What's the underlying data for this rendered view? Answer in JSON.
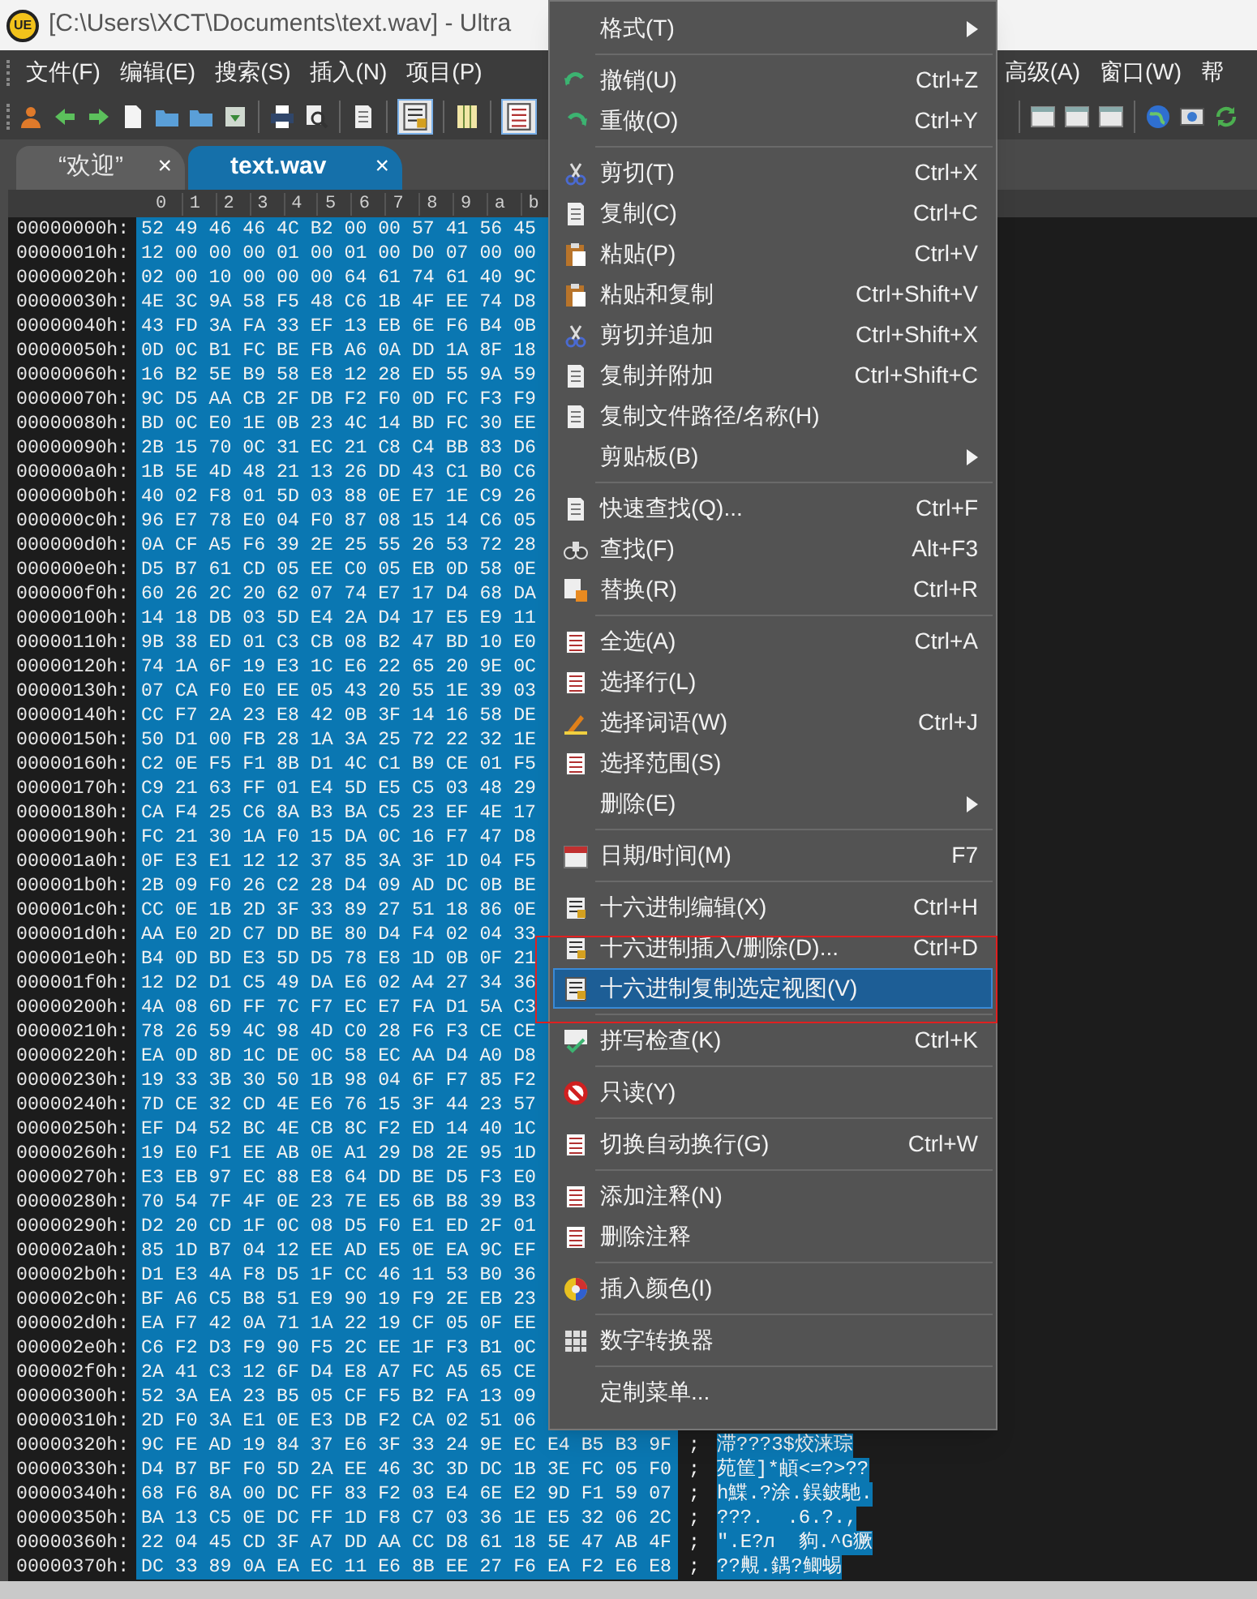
{
  "window": {
    "logo_text": "UE",
    "title": "[C:\\Users\\XCT\\Documents\\text.wav] - Ultra"
  },
  "menu_bar_left": [
    "文件(F)",
    "编辑(E)",
    "搜索(S)",
    "插入(N)",
    "项目(P)"
  ],
  "menu_bar_right": [
    "高级(A)",
    "窗口(W)",
    "帮"
  ],
  "tabs": [
    {
      "label": "“欢迎”",
      "close": "×",
      "selected": false
    },
    {
      "label": "text.wav",
      "close": "×",
      "selected": true
    }
  ],
  "hex_view": {
    "column_headers": [
      "0",
      "1",
      "2",
      "3",
      "4",
      "5",
      "6",
      "7",
      "8",
      "9",
      "a",
      "b"
    ],
    "rows": [
      {
        "address": "00000000h:",
        "bytes": "52 49 46 46 4C B2 00 00 57 41 56 45"
      },
      {
        "address": "00000010h:",
        "bytes": "12 00 00 00 01 00 01 00 D0 07 00 00"
      },
      {
        "address": "00000020h:",
        "bytes": "02 00 10 00 00 00 64 61 74 61 40 9C"
      },
      {
        "address": "00000030h:",
        "bytes": "4E 3C 9A 58 F5 48 C6 1B 4F EE 74 D8"
      },
      {
        "address": "00000040h:",
        "bytes": "43 FD 3A FA 33 EF 13 EB 6E F6 B4 0B"
      },
      {
        "address": "00000050h:",
        "bytes": "0D 0C B1 FC BE FB A6 0A DD 1A 8F 18"
      },
      {
        "address": "00000060h:",
        "bytes": "16 B2 5E B9 58 E8 12 28 ED 55 9A 59"
      },
      {
        "address": "00000070h:",
        "bytes": "9C D5 AA CB 2F DB F2 F0 0D FC F3 F9"
      },
      {
        "address": "00000080h:",
        "bytes": "BD 0C E0 1E 0B 23 4C 14 BD FC 30 EE"
      },
      {
        "address": "00000090h:",
        "bytes": "2B 15 70 0C 31 EC 21 C8 C4 BB 83 D6"
      },
      {
        "address": "000000a0h:",
        "bytes": "1B 5E 4D 48 21 13 26 DD 43 C1 B0 C6"
      },
      {
        "address": "000000b0h:",
        "bytes": "40 02 F8 01 5D 03 88 0E E7 1E C9 26"
      },
      {
        "address": "000000c0h:",
        "bytes": "96 E7 78 E0 04 F0 87 08 15 14 C6 05"
      },
      {
        "address": "000000d0h:",
        "bytes": "0A CF A5 F6 39 2E 25 55 26 53 72 28"
      },
      {
        "address": "000000e0h:",
        "bytes": "D5 B7 61 CD 05 EE C0 05 EB 0D 58 0E"
      },
      {
        "address": "000000f0h:",
        "bytes": "60 26 2C 20 62 07 74 E7 17 D4 68 DA"
      },
      {
        "address": "00000100h:",
        "bytes": "14 18 DB 03 5D E4 2A D4 17 E5 E9 11"
      },
      {
        "address": "00000110h:",
        "bytes": "9B 38 ED 01 C3 CB 08 B2 47 BD 10 E0"
      },
      {
        "address": "00000120h:",
        "bytes": "74 1A 6F 19 E3 1C E6 22 65 20 9E 0C"
      },
      {
        "address": "00000130h:",
        "bytes": "07 CA F0 E0 EE 05 43 20 55 1E 39 03"
      },
      {
        "address": "00000140h:",
        "bytes": "CC F7 2A 23 E8 42 0B 3F 14 16 58 DE"
      },
      {
        "address": "00000150h:",
        "bytes": "50 D1 00 FB 28 1A 3A 25 72 22 32 1E"
      },
      {
        "address": "00000160h:",
        "bytes": "C2 0E F5 F1 8B D1 4C C1 B9 CE 01 F5"
      },
      {
        "address": "00000170h:",
        "bytes": "C9 21 63 FF 01 E4 5D E5 C5 03 48 29"
      },
      {
        "address": "00000180h:",
        "bytes": "CA F4 25 C6 8A B3 BA C5 23 EF 4E 17"
      },
      {
        "address": "00000190h:",
        "bytes": "FC 21 30 1A F0 15 DA 0C 16 F7 47 D8"
      },
      {
        "address": "000001a0h:",
        "bytes": "0F E3 E1 12 12 37 85 3A 3F 1D 04 F5"
      },
      {
        "address": "000001b0h:",
        "bytes": "2B 09 F0 26 C2 28 D4 09 AD DC 0B BE"
      },
      {
        "address": "000001c0h:",
        "bytes": "CC 0E 1B 2D 3F 33 89 27 51 18 86 0E"
      },
      {
        "address": "000001d0h:",
        "bytes": "AA E0 2D C7 DD BE 80 D4 F4 02 04 33"
      },
      {
        "address": "000001e0h:",
        "bytes": "B4 0D BD E3 5D D5 78 E8 1D 0B 0F 21"
      },
      {
        "address": "000001f0h:",
        "bytes": "12 D2 D1 C5 49 DA E6 02 A4 27 34 36"
      },
      {
        "address": "00000200h:",
        "bytes": "4A 08 6D FF 7C F7 EC E7 FA D1 5A C3"
      },
      {
        "address": "00000210h:",
        "bytes": "78 26 59 4C 98 4D C0 28 F6 F3 CE CE"
      },
      {
        "address": "00000220h:",
        "bytes": "EA 0D 8D 1C DE 0C 58 EC AA D4 A0 D8"
      },
      {
        "address": "00000230h:",
        "bytes": "19 33 3B 30 50 1B 98 04 6F F7 85 F2"
      },
      {
        "address": "00000240h:",
        "bytes": "7D CE 32 CD 4E E6 76 15 3F 44 23 57"
      },
      {
        "address": "00000250h:",
        "bytes": "EF D4 52 BC 4E CB 8C F2 ED 14 40 1C"
      },
      {
        "address": "00000260h:",
        "bytes": "19 E0 F1 EE AB 0E A1 29 D8 2E 95 1D"
      },
      {
        "address": "00000270h:",
        "bytes": "E3 EB 97 EC 88 E8 64 DD BE D5 F3 E0"
      },
      {
        "address": "00000280h:",
        "bytes": "70 54 7F 4F 0E 23 7E E5 6B B8 39 B3"
      },
      {
        "address": "00000290h:",
        "bytes": "D2 20 CD 1F 0C 08 D5 F0 E1 ED 2F 01"
      },
      {
        "address": "000002a0h:",
        "bytes": "85 1D B7 04 12 EE AD E5 0E EA 9C EF"
      },
      {
        "address": "000002b0h:",
        "bytes": "D1 E3 4A F8 D5 1F CC 46 11 53 B0 36"
      },
      {
        "address": "000002c0h:",
        "bytes": "BF A6 C5 B8 51 E9 90 19 F9 2E EB 23"
      },
      {
        "address": "000002d0h:",
        "bytes": "EA F7 42 0A 71 1A 22 19 CF 05 0F EE"
      },
      {
        "address": "000002e0h:",
        "bytes": "C6 F2 D3 F9 90 F5 2C EE 1F F3 B1 0C"
      },
      {
        "address": "000002f0h:",
        "bytes": "2A 41 C3 12 6F D4 E8 A7 FC A5 65 CE"
      },
      {
        "address": "00000300h:",
        "bytes": "52 3A EA 23 B5 05 CF F5 B2 FA 13 09"
      },
      {
        "address": "00000310h:",
        "bytes": "2D F0 3A E1 0E E3 DB F2 CA 02 51 06"
      },
      {
        "address": "00000320h:",
        "bytes": "9C FE AD 19 84 37 E6 3F 33 24 9E EC E4 B5 B3 9F",
        "separator": ";",
        "text": "滞???3$烄涞琮"
      },
      {
        "address": "00000330h:",
        "bytes": "D4 B7 BF F0 5D 2A EE 46 3C 3D DC 1B 3E FC 05 F0",
        "separator": ";",
        "text": "苑筐]*頔<=?>??"
      },
      {
        "address": "00000340h:",
        "bytes": "68 F6 8A 00 DC FF 83 F2 03 E4 6E E2 9D F1 59 07",
        "separator": ";",
        "text": "h鰈.?涂.鋘鈹馳."
      },
      {
        "address": "00000350h:",
        "bytes": "BA 13 C5 0E DC FF 1D F8 C7 03 36 1E E5 32 06 2C",
        "separator": ";",
        "text": "???.  .6.?.,"
      },
      {
        "address": "00000360h:",
        "bytes": "22 04 45 CD 3F A7 DD AA CC D8 61 18 5E 47 AB 4F",
        "separator": ";",
        "text": "\".E?л  豿.^G獗"
      },
      {
        "address": "00000370h:",
        "bytes": "DC 33 89 0A EA EC 11 E6 8B EE 27 F6 EA F2 E6 E8",
        "separator": ";",
        "text": "??覥.鍝?鲫蜴"
      }
    ]
  },
  "context_menu": {
    "items": [
      {
        "kind": "item",
        "label": "格式(T)",
        "submenu": true,
        "selected": false
      },
      {
        "kind": "separator"
      },
      {
        "kind": "item",
        "label": "撤销(U)",
        "shortcut": "Ctrl+Z",
        "selected": false
      },
      {
        "kind": "item",
        "label": "重做(O)",
        "shortcut": "Ctrl+Y",
        "selected": false
      },
      {
        "kind": "separator"
      },
      {
        "kind": "item",
        "label": "剪切(T)",
        "shortcut": "Ctrl+X",
        "selected": false
      },
      {
        "kind": "item",
        "label": "复制(C)",
        "shortcut": "Ctrl+C",
        "selected": false
      },
      {
        "kind": "item",
        "label": "粘贴(P)",
        "shortcut": "Ctrl+V",
        "selected": false
      },
      {
        "kind": "item",
        "label": "粘贴和复制",
        "shortcut": "Ctrl+Shift+V",
        "selected": false
      },
      {
        "kind": "item",
        "label": "剪切并追加",
        "shortcut": "Ctrl+Shift+X",
        "selected": false
      },
      {
        "kind": "item",
        "label": "复制并附加",
        "shortcut": "Ctrl+Shift+C",
        "selected": false
      },
      {
        "kind": "item",
        "label": "复制文件路径/名称(H)",
        "selected": false
      },
      {
        "kind": "item",
        "label": "剪贴板(B)",
        "submenu": true,
        "selected": false
      },
      {
        "kind": "separator"
      },
      {
        "kind": "item",
        "label": "快速查找(Q)...",
        "shortcut": "Ctrl+F",
        "selected": false
      },
      {
        "kind": "item",
        "label": "查找(F)",
        "shortcut": "Alt+F3",
        "selected": false
      },
      {
        "kind": "item",
        "label": "替换(R)",
        "shortcut": "Ctrl+R",
        "selected": false
      },
      {
        "kind": "separator"
      },
      {
        "kind": "item",
        "label": "全选(A)",
        "shortcut": "Ctrl+A",
        "selected": false
      },
      {
        "kind": "item",
        "label": "选择行(L)",
        "selected": false
      },
      {
        "kind": "item",
        "label": "选择词语(W)",
        "shortcut": "Ctrl+J",
        "selected": false
      },
      {
        "kind": "item",
        "label": "选择范围(S)",
        "selected": false
      },
      {
        "kind": "item",
        "label": "删除(E)",
        "submenu": true,
        "selected": false
      },
      {
        "kind": "separator"
      },
      {
        "kind": "item",
        "label": "日期/时间(M)",
        "shortcut": "F7",
        "selected": false
      },
      {
        "kind": "separator"
      },
      {
        "kind": "item",
        "label": "十六进制编辑(X)",
        "shortcut": "Ctrl+H",
        "selected": false
      },
      {
        "kind": "item",
        "label": "十六进制插入/删除(D)...",
        "shortcut": "Ctrl+D",
        "selected": false
      },
      {
        "kind": "item",
        "label": "十六进制复制选定视图(V)",
        "selected": true
      },
      {
        "kind": "separator"
      },
      {
        "kind": "item",
        "label": "拼写检查(K)",
        "shortcut": "Ctrl+K",
        "selected": false
      },
      {
        "kind": "separator"
      },
      {
        "kind": "item",
        "label": "只读(Y)",
        "selected": false
      },
      {
        "kind": "separator"
      },
      {
        "kind": "item",
        "label": "切换自动换行(G)",
        "shortcut": "Ctrl+W",
        "selected": false
      },
      {
        "kind": "separator"
      },
      {
        "kind": "item",
        "label": "添加注释(N)",
        "selected": false
      },
      {
        "kind": "item",
        "label": "删除注释",
        "selected": false
      },
      {
        "kind": "separator"
      },
      {
        "kind": "item",
        "label": "插入颜色(I)",
        "selected": false
      },
      {
        "kind": "separator"
      },
      {
        "kind": "item",
        "label": "数字转换器",
        "selected": false
      },
      {
        "kind": "separator"
      },
      {
        "kind": "item",
        "label": "定制菜单...",
        "selected": false
      }
    ]
  }
}
